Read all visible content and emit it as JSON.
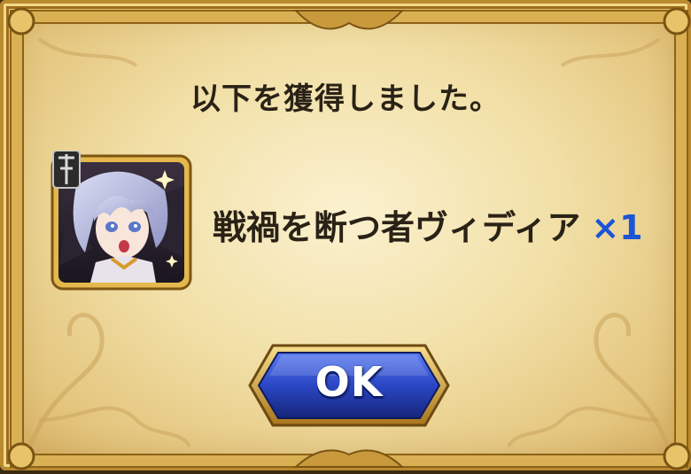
{
  "dialog": {
    "title": "以下を獲得しました。",
    "reward": {
      "name": "戦禍を断つ者ヴィディア",
      "quantity": "×1",
      "icon": "character-portrait-icon"
    },
    "ok_label": "OK"
  },
  "colors": {
    "parchment": "#f1dfa6",
    "frame_gold": "#b98a2e",
    "quantity_blue": "#1b55d6",
    "button_blue": "#2a46c4",
    "text_dark": "#2a2216"
  }
}
